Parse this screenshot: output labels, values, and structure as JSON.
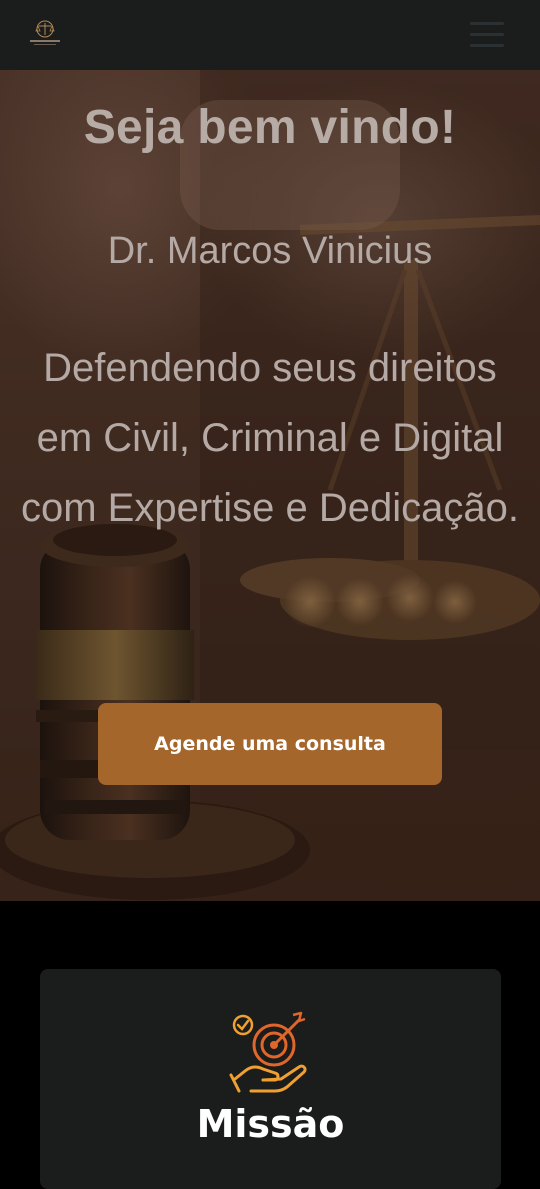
{
  "header": {
    "logo_icon": "scales-of-justice-logo-icon",
    "menu_icon": "hamburger-menu-icon"
  },
  "hero": {
    "title": "Seja bem vindo!",
    "name": "Dr. Marcos Vinicius",
    "tagline": "Defendendo seus direitos em Civil, Criminal e Digital com Expertise e Dedicação.",
    "cta_label": "Agende uma consulta",
    "background_image": "gavel-and-scales-photo"
  },
  "mission": {
    "icon": "target-in-hand-icon",
    "title": "Missão"
  },
  "colors": {
    "header_bg": "#1b1c1c",
    "cta_bg": "#a5662b",
    "card_bg": "#1b1c1c",
    "icon_orange": "#e0662a",
    "icon_amber": "#f0a030"
  }
}
